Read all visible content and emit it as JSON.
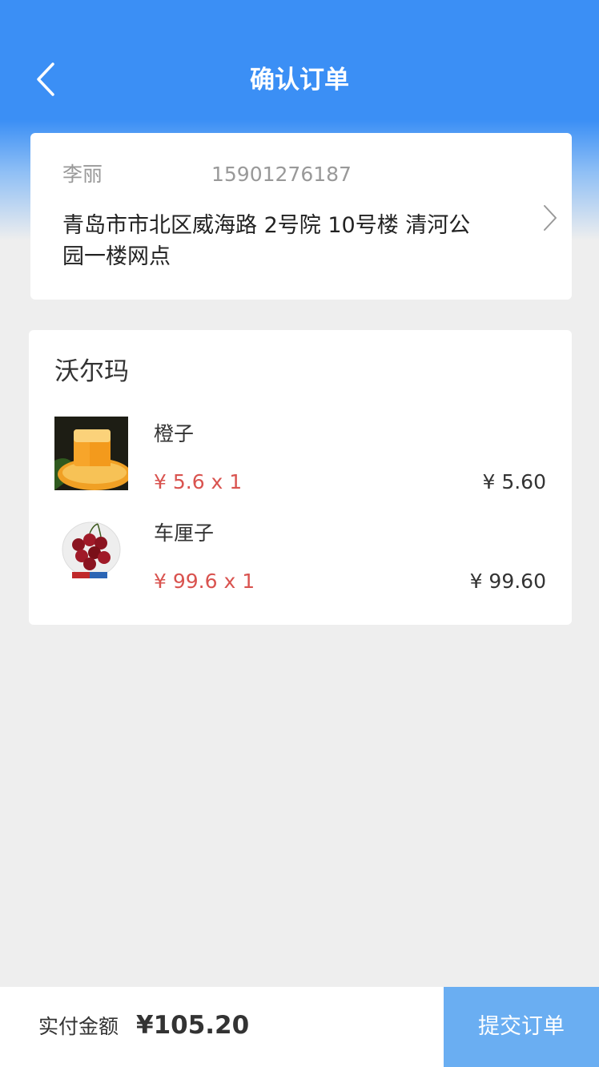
{
  "header": {
    "title": "确认订单",
    "back_icon": "chevron-left-icon",
    "color": "#3b8ff5"
  },
  "address": {
    "name": "李丽",
    "phone": "15901276187",
    "detail": "青岛市市北区威海路 2号院 10号楼 清河公园一楼网点",
    "arrow_icon": "chevron-right-icon"
  },
  "store": {
    "name": "沃尔玛",
    "items": [
      {
        "name": "橙子",
        "price_qty": "¥ 5.6 x 1",
        "subtotal": "¥ 5.60",
        "image": "orange-image"
      },
      {
        "name": "车厘子",
        "price_qty": "¥ 99.6 x 1",
        "subtotal": "¥ 99.60",
        "image": "cherries-image"
      }
    ]
  },
  "footer": {
    "total_label": "实付金额",
    "total_value": "¥105.20",
    "submit_label": "提交订单",
    "submit_color": "#6aaef2"
  },
  "colors": {
    "price_red": "#d9534f",
    "background": "#eeeeee"
  }
}
